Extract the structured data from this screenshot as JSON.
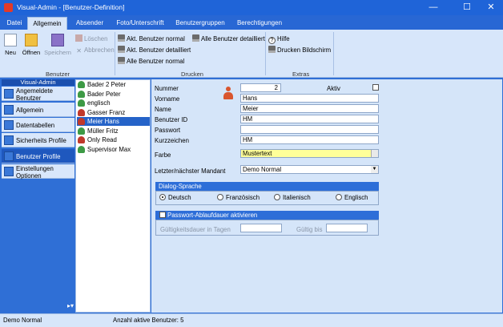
{
  "window": {
    "title": "Visual-Admin - [Benutzer-Definition]",
    "controls": {
      "minimize": "—",
      "maximize": "☐",
      "close": "✕"
    }
  },
  "tabs": [
    "Datei",
    "Allgemein",
    "Absender",
    "Foto/Unterschrift",
    "Benutzergruppen",
    "Berechtigungen"
  ],
  "ribbon": {
    "benutzer": {
      "label": "Benutzer",
      "neu": "Neu",
      "oeffnen": "Öffnen",
      "speichern": "Speichern",
      "loeschen": "Löschen",
      "abbrechen": "Abbrechen"
    },
    "drucken": {
      "label": "Drucken",
      "akt_normal": "Akt. Benutzer normal",
      "akt_detail": "Akt. Benutzer detailliert",
      "alle_normal": "Alle Benutzer normal",
      "alle_detail": "Alle Benutzer detailliert"
    },
    "extras": {
      "label": "Extras",
      "hilfe": "Hilfe",
      "drucken_bildschirm": "Drucken Bildschirm"
    }
  },
  "nav": {
    "header": "Visual-Admin",
    "items": [
      "Angemeldete Benutzer",
      "Allgemein",
      "Datentabellen",
      "Sicherheits Profile",
      "Benutzer Profile",
      "Einstellungen Optionen"
    ],
    "more": "▸▾"
  },
  "users": [
    {
      "name": "Bader 2 Peter",
      "color": "#3d9a45"
    },
    {
      "name": "Bader Peter",
      "color": "#3d9a45"
    },
    {
      "name": "englisch",
      "color": "#3d9a45"
    },
    {
      "name": "Gasser Franz",
      "color": "#c0392b"
    },
    {
      "name": "Meier Hans",
      "color": "#c0392b"
    },
    {
      "name": "Müller Fritz",
      "color": "#3d9a45"
    },
    {
      "name": "Only Read",
      "color": "#c0392b"
    },
    {
      "name": "Supervisor Max",
      "color": "#3d9a45"
    }
  ],
  "form": {
    "labels": {
      "nummer": "Nummer",
      "aktiv": "Aktiv",
      "vorname": "Vorname",
      "name": "Name",
      "benutzer_id": "Benutzer ID",
      "passwort": "Passwort",
      "kurzzeichen": "Kurzzeichen",
      "farbe": "Farbe",
      "mandant": "Letzter/nächster Mandant"
    },
    "values": {
      "nummer": "2",
      "vorname": "Hans",
      "name": "Meier",
      "benutzer_id": "HM",
      "passwort": "",
      "kurzzeichen": "HM",
      "farbe": "Mustertext",
      "mandant": "Demo Normal"
    },
    "dialog_sprache": {
      "title": "Dialog-Sprache",
      "options": [
        "Deutsch",
        "Französisch",
        "Italienisch",
        "Englisch"
      ]
    },
    "passwort_ablauf": {
      "title": "Passwort-Ablaufdauer aktivieren",
      "gueltigkeit": "Gültigkeitsdauer in Tagen",
      "gueltig_bis": "Gültig bis"
    }
  },
  "status": {
    "mandant": "Demo Normal",
    "aktive": "Anzahl aktive Benutzer: 5"
  },
  "colors": {
    "accent": "#2d6ed8",
    "ribbon": "#d7e6fa",
    "selection": "#2563c8"
  }
}
